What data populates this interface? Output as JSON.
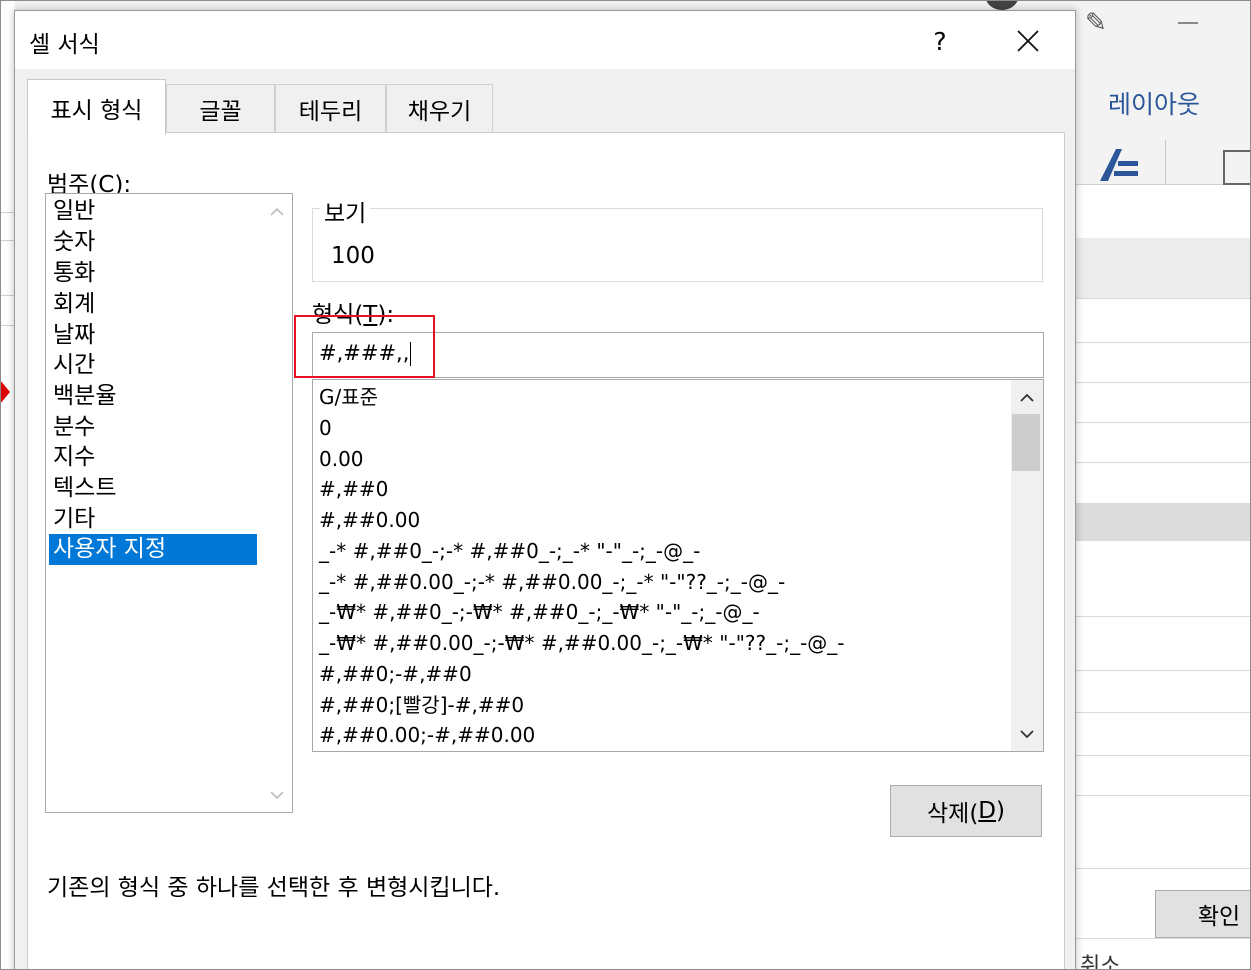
{
  "dialog": {
    "title": "셀 서식",
    "help_label": "?",
    "tabs": [
      {
        "label": "표시 형식",
        "active": true
      },
      {
        "label": "글꼴",
        "active": false
      },
      {
        "label": "테두리",
        "active": false
      },
      {
        "label": "채우기",
        "active": false
      }
    ],
    "category": {
      "label_prefix": "범주(",
      "label_key": "C",
      "label_suffix": "):",
      "items": [
        "일반",
        "숫자",
        "통화",
        "회계",
        "날짜",
        "시간",
        "백분율",
        "분수",
        "지수",
        "텍스트",
        "기타",
        "사용자 지정"
      ],
      "selected": "사용자 지정"
    },
    "preview": {
      "legend": "보기",
      "value": "100"
    },
    "format": {
      "label_prefix": "형식(",
      "label_key": "T",
      "label_suffix": "):",
      "value": "#,###,,"
    },
    "format_list": [
      "G/표준",
      "0",
      "0.00",
      "#,##0",
      "#,##0.00",
      "_-* #,##0_-;-* #,##0_-;_-* \"-\"_-;_-@_-",
      "_-* #,##0.00_-;-* #,##0.00_-;_-* \"-\"??_-;_-@_-",
      "_-₩* #,##0_-;-₩* #,##0_-;_-₩* \"-\"_-;_-@_-",
      "_-₩* #,##0.00_-;-₩* #,##0.00_-;_-₩* \"-\"??_-;_-@_-",
      "#,##0;-#,##0",
      "#,##0;[빨강]-#,##0",
      "#,##0.00;-#,##0.00"
    ],
    "delete_button": {
      "prefix": "삭제(",
      "key": "D",
      "suffix": ")"
    },
    "hint": "기존의 형식 중 하나를 선택한 후 변형시킵니다.",
    "colors": {
      "selection": "#0078d7",
      "highlight_box": "#e81123"
    }
  },
  "background": {
    "ribbon_tab": "레이아웃",
    "ok_button": "확인",
    "cancel_fragment": "취소"
  }
}
